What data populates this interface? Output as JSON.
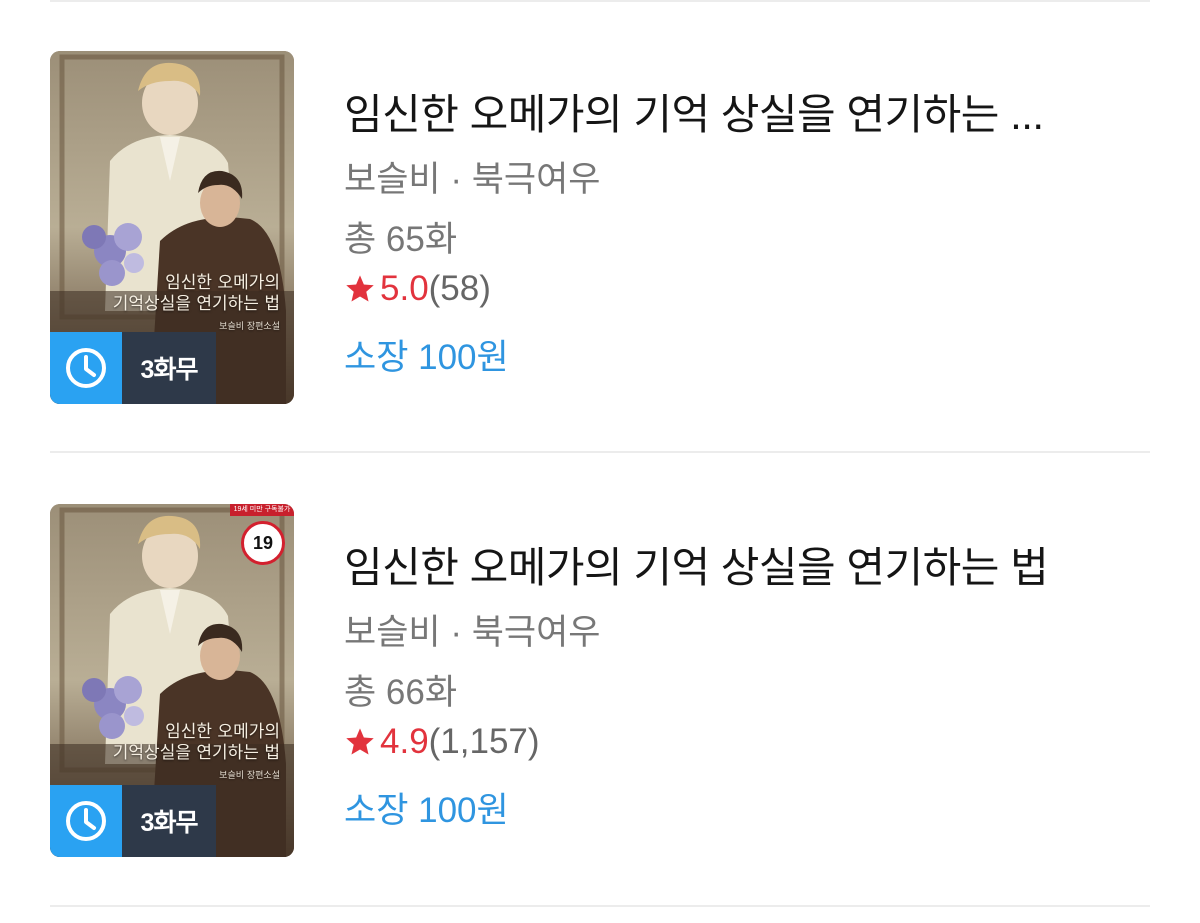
{
  "list": {
    "items": [
      {
        "title": "임신한 오메가의 기억 상실을 연기하는 ...",
        "authors": "보슬비 · 북극여우",
        "episodes": "총 65화",
        "rating_score": "5.0",
        "rating_count": "(58)",
        "price": "소장 100원",
        "free_badge": "3화무",
        "cover_text": {
          "line1": "임신한 오메가의",
          "line2": "기억상실을 연기하는 법",
          "line3": "보슬비 장편소설"
        },
        "adult": false
      },
      {
        "title": "임신한 오메가의 기억 상실을 연기하는 법",
        "authors": "보슬비 · 북극여우",
        "episodes": "총 66화",
        "rating_score": "4.9",
        "rating_count": "(1,157)",
        "price": "소장 100원",
        "free_badge": "3화무",
        "cover_text": {
          "line1": "임신한 오메가의",
          "line2": "기억상실을 연기하는 법",
          "line3": "보슬비 장편소설"
        },
        "adult": true,
        "age_label": "19",
        "age_strip": "19세 미만 구독불가"
      }
    ]
  },
  "icons": {
    "star": "star-icon",
    "clock": "clock-icon"
  },
  "colors": {
    "rating": "#e2333d",
    "price": "#2f95e0",
    "free_badge_icon_bg": "#2aa2f2",
    "free_badge_label_bg": "#2e3949",
    "adult_badge": "#d3202e"
  }
}
